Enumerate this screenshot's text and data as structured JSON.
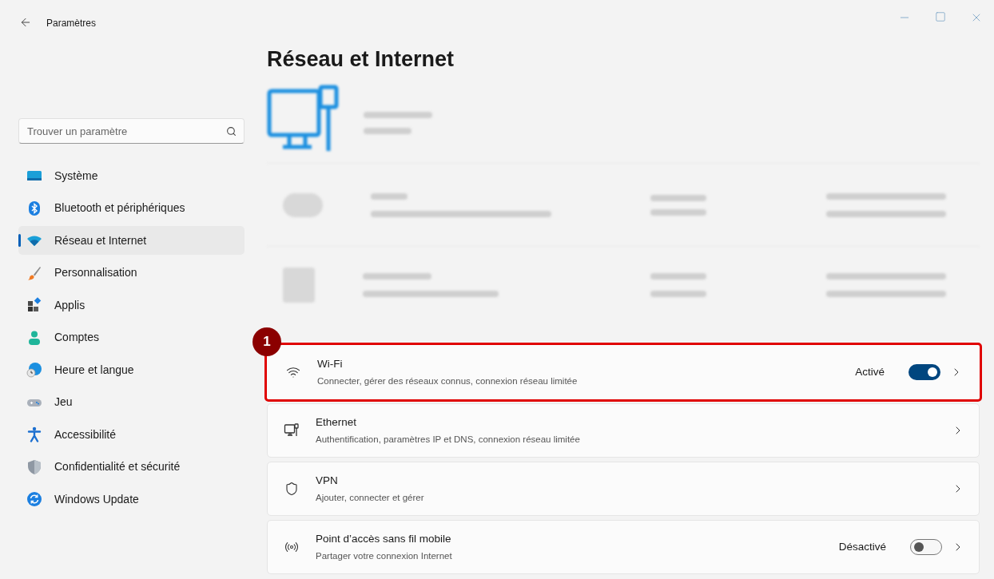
{
  "window": {
    "title": "Paramètres"
  },
  "sidebar": {
    "search": {
      "placeholder": "Trouver un paramètre"
    },
    "items": [
      {
        "label": "Système",
        "kind": "system",
        "selected": false
      },
      {
        "label": "Bluetooth et périphériques",
        "kind": "bluetooth",
        "selected": false
      },
      {
        "label": "Réseau et Internet",
        "kind": "network",
        "selected": true
      },
      {
        "label": "Personnalisation",
        "kind": "brush",
        "selected": false
      },
      {
        "label": "Applis",
        "kind": "apps",
        "selected": false
      },
      {
        "label": "Comptes",
        "kind": "person",
        "selected": false
      },
      {
        "label": "Heure et langue",
        "kind": "globe",
        "selected": false
      },
      {
        "label": "Jeu",
        "kind": "gamepad",
        "selected": false
      },
      {
        "label": "Accessibilité",
        "kind": "accessibility",
        "selected": false
      },
      {
        "label": "Confidentialité et sécurité",
        "kind": "shield",
        "selected": false
      },
      {
        "label": "Windows Update",
        "kind": "update",
        "selected": false
      }
    ]
  },
  "page": {
    "title": "Réseau et Internet",
    "cards": [
      {
        "kind": "wifi",
        "title": "Wi-Fi",
        "subtitle": "Connecter, gérer des réseaux connus, connexion réseau limitée",
        "status": "Activé",
        "on": true,
        "highlighted": true,
        "badge": "1"
      },
      {
        "kind": "ethernet",
        "title": "Ethernet",
        "subtitle": "Authentification, paramètres IP et DNS, connexion réseau limitée",
        "highlighted": false
      },
      {
        "kind": "vpn",
        "title": "VPN",
        "subtitle": "Ajouter, connecter et gérer",
        "highlighted": false
      },
      {
        "kind": "hotspot",
        "title": "Point d’accès sans fil mobile",
        "subtitle": "Partager votre connexion Internet",
        "status": "Désactivé",
        "on": false,
        "highlighted": false
      }
    ]
  }
}
